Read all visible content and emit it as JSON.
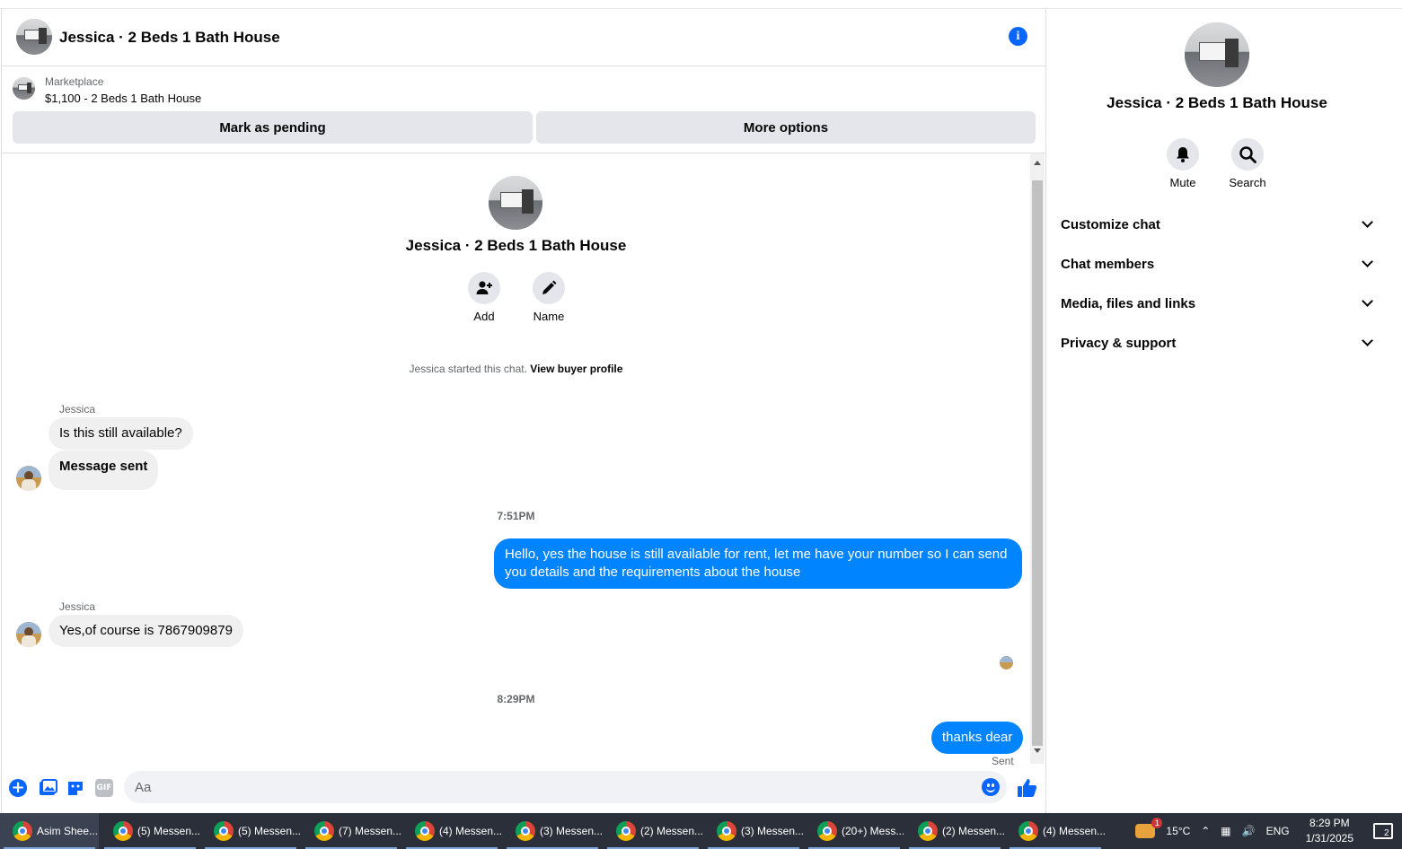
{
  "header": {
    "title": "Jessica · 2 Beds 1 Bath House"
  },
  "marketplace": {
    "kicker": "Marketplace",
    "item": "$1,100 - 2 Beds 1 Bath House",
    "pending_button": "Mark as pending",
    "more_button": "More options"
  },
  "conversation": {
    "title": "Jessica · 2 Beds 1 Bath House",
    "actions": [
      {
        "label": "Add",
        "icon": "add-person-icon"
      },
      {
        "label": "Name",
        "icon": "pencil-icon"
      }
    ],
    "started_text": "Jessica started this chat.",
    "started_link": "View buyer profile",
    "messages": [
      {
        "sender": "Jessica",
        "text": "Is this still available?"
      },
      {
        "text": "Message sent"
      },
      {
        "timestamp": "7:51PM"
      },
      {
        "from_me": true,
        "text_line1": "Hello, yes the house is still available for rent, let me have your number so I can send",
        "text_line2": "you details and the requirements about the house"
      },
      {
        "sender": "Jessica",
        "text": "Yes,of course is 7867909879"
      },
      {
        "timestamp": "8:29PM"
      },
      {
        "from_me": true,
        "text": "thanks dear",
        "status": "Sent"
      }
    ]
  },
  "composer": {
    "placeholder": "Aa"
  },
  "info_panel": {
    "title": "Jessica · 2 Beds 1 Bath House",
    "mute_label": "Mute",
    "search_label": "Search",
    "sections": [
      "Customize chat",
      "Chat members",
      "Media, files and links",
      "Privacy & support"
    ]
  },
  "taskbar": {
    "apps": [
      "Asim Shee...",
      "(5) Messen...",
      "(5) Messen...",
      "(7) Messen...",
      "(4) Messen...",
      "(3) Messen...",
      "(2) Messen...",
      "(3) Messen...",
      "(20+) Mess...",
      "(2) Messen...",
      "(4) Messen..."
    ],
    "weather_badge": "1",
    "temperature": "15°C",
    "language": "ENG",
    "time": "8:29 PM",
    "date": "1/31/2025",
    "notification_count": "2"
  },
  "colors": {
    "accent": "#0866ff",
    "outgoing_bubble": "#0084ff",
    "incoming_bubble": "#f0f0f0"
  }
}
